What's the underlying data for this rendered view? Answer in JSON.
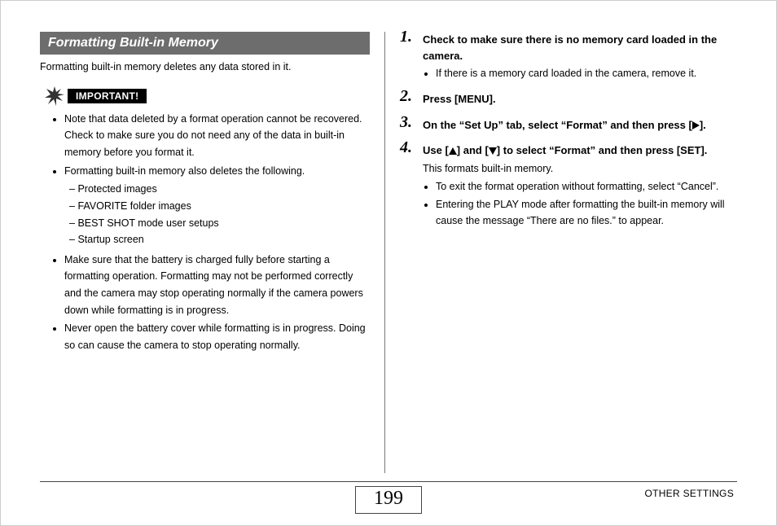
{
  "section_title": "Formatting Built-in Memory",
  "intro": "Formatting built-in memory deletes any data stored in it.",
  "important_label": "IMPORTANT!",
  "important_bullets": {
    "b1": "Note that data deleted by a format operation cannot be recovered. Check to make sure you do not need any of the data in built-in memory before you format it.",
    "b2": "Formatting built-in memory also deletes the following.",
    "b2_sub": {
      "s1": "Protected images",
      "s2": "FAVORITE folder images",
      "s3": "BEST SHOT mode user setups",
      "s4": "Startup screen"
    },
    "b3": "Make sure that the battery is charged fully before starting a formatting operation. Formatting may not be performed correctly and the camera may stop operating normally if the camera powers down while formatting is in progress.",
    "b4": "Never open the battery cover while formatting is in progress. Doing so can cause the camera to stop operating normally."
  },
  "steps": {
    "s1": {
      "num": "1.",
      "head": "Check to make sure there is no memory card loaded in the camera.",
      "bullets": {
        "b1": "If there is a memory card loaded in the camera, remove it."
      }
    },
    "s2": {
      "num": "2.",
      "head": "Press [MENU]."
    },
    "s3": {
      "num": "3.",
      "head_pre": "On the “Set Up” tab, select “Format” and then press [",
      "head_post": "]."
    },
    "s4": {
      "num": "4.",
      "head_pre": "Use [",
      "head_mid": "] and [",
      "head_post": "] to select “Format” and then press [SET].",
      "body": "This formats built-in memory.",
      "bullets": {
        "b1": "To exit the format operation without formatting, select “Cancel”.",
        "b2": "Entering the PLAY mode after formatting the built-in memory will cause the message “There are no files.” to appear."
      }
    }
  },
  "page_number": "199",
  "footer_label": "OTHER SETTINGS"
}
